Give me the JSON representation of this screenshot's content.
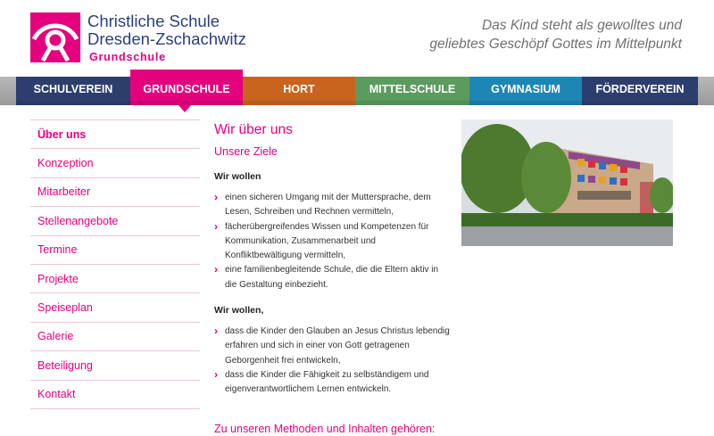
{
  "header": {
    "name_line1": "Christliche Schule",
    "name_line2": "Dresden-Zschachwitz",
    "subtitle": "Grundschule",
    "tagline_line1": "Das Kind steht als gewolltes und",
    "tagline_line2": "geliebtes Geschöpf Gottes im Mittelpunkt",
    "logo_color": "#e5007e"
  },
  "nav": {
    "items": [
      {
        "label": "SCHULVEREIN",
        "color": "#2b3e6e"
      },
      {
        "label": "GRUNDSCHULE",
        "color": "#e5007e"
      },
      {
        "label": "HORT",
        "color": "#c8641e"
      },
      {
        "label": "MITTELSCHULE",
        "color": "#5b9c5e"
      },
      {
        "label": "GYMNASIUM",
        "color": "#1e86b4"
      },
      {
        "label": "FÖRDERVEREIN",
        "color": "#2b3e6e"
      }
    ],
    "active_index": 1
  },
  "sidebar": {
    "items": [
      {
        "label": "Über uns"
      },
      {
        "label": "Konzeption"
      },
      {
        "label": "Mitarbeiter"
      },
      {
        "label": "Stellenangebote"
      },
      {
        "label": "Termine"
      },
      {
        "label": "Projekte"
      },
      {
        "label": "Speiseplan"
      },
      {
        "label": "Galerie"
      },
      {
        "label": "Beteiligung"
      },
      {
        "label": "Kontakt"
      }
    ]
  },
  "content": {
    "title": "Wir über uns",
    "subtitle": "Unsere Ziele",
    "section1_heading": "Wir wollen",
    "section1_items": [
      "einen sicheren Umgang mit der Muttersprache, dem Lesen, Schreiben und Rechnen vermitteln,",
      "fächerübergreifendes Wissen und Kompetenzen für Kommunikation, Zusammenarbeit und Konfliktbewältigung vermitteln,",
      "eine familienbegleitende Schule, die die Eltern aktiv in die Gestaltung einbezieht."
    ],
    "section2_heading": "Wir wollen,",
    "section2_items": [
      "dass die Kinder den Glauben an Jesus Christus lebendig erfahren und sich in einer von Gott getragenen Geborgenheit frei entwickeln,",
      "dass die Kinder die Fähigkeit zu selbständigem und eigenverantwortlichem Lernen entwickeln."
    ],
    "methods_heading": "Zu unseren Methoden und Inhalten gehören:"
  },
  "photo": {
    "icon": "school-building-photo"
  }
}
